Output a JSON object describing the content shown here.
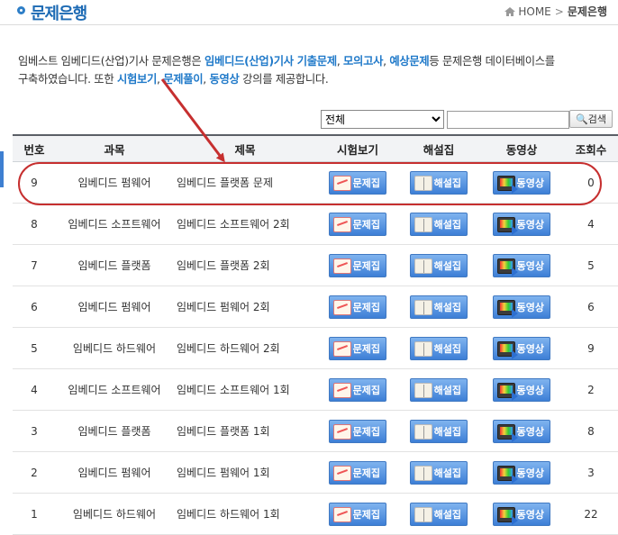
{
  "header": {
    "title": "문제은행",
    "breadcrumb_home": "HOME",
    "breadcrumb_sep": ">",
    "breadcrumb_current": "문제은행"
  },
  "intro": {
    "line1_a": "임베스트 임베디드(산업)기사 문제은행은 ",
    "line1_hl1": "임베디드(산업)기사 기출문제",
    "line1_b": ", ",
    "line1_hl2": "모의고사",
    "line1_c": ", ",
    "line1_hl3": "예상문제",
    "line1_d": "등 문제은행 데이터베이스를",
    "line2_a": "구축하였습니다. 또한 ",
    "line2_hl1": "시험보기",
    "line2_b": ", ",
    "line2_hl2": "문제풀이",
    "line2_c": ", ",
    "line2_hl3": "동영상",
    "line2_d": " 강의를 제공합니다."
  },
  "search": {
    "select_value": "전체",
    "input_value": "",
    "button_label": "검색"
  },
  "table": {
    "headers": [
      "번호",
      "과목",
      "제목",
      "시험보기",
      "해설집",
      "동영상",
      "조회수"
    ],
    "button_labels": {
      "exam": "문제집",
      "solution": "해설집",
      "video": "동영상"
    },
    "rows": [
      {
        "no": "9",
        "subject": "임베디드 펌웨어",
        "title": "임베디드 플랫폼 문제",
        "views": "0"
      },
      {
        "no": "8",
        "subject": "임베디드 소프트웨어",
        "title": "임베디드 소프트웨어 2회",
        "views": "4"
      },
      {
        "no": "7",
        "subject": "임베디드 플랫폼",
        "title": "임베디드 플랫폼 2회",
        "views": "5"
      },
      {
        "no": "6",
        "subject": "임베디드 펌웨어",
        "title": "임베디드 펌웨어 2회",
        "views": "6"
      },
      {
        "no": "5",
        "subject": "임베디드 하드웨어",
        "title": "임베디드 하드웨어 2회",
        "views": "9"
      },
      {
        "no": "4",
        "subject": "임베디드 소프트웨어",
        "title": "임베디드 소프트웨어 1회",
        "views": "2"
      },
      {
        "no": "3",
        "subject": "임베디드 플랫폼",
        "title": "임베디드 플랫폼 1회",
        "views": "8"
      },
      {
        "no": "2",
        "subject": "임베디드 펌웨어",
        "title": "임베디드 펌웨어 1회",
        "views": "3"
      },
      {
        "no": "1",
        "subject": "임베디드 하드웨어",
        "title": "임베디드 하드웨어 1회",
        "views": "22"
      }
    ]
  },
  "icons": {
    "title_bullet": "circle-bullet-icon",
    "home": "home-icon",
    "search": "search-icon",
    "exam": "book-icon",
    "solution": "open-book-icon",
    "video": "tv-icon"
  },
  "colors": {
    "accent": "#1c6ab4",
    "highlight": "#1f79c9",
    "annotation": "#c62f2f"
  }
}
